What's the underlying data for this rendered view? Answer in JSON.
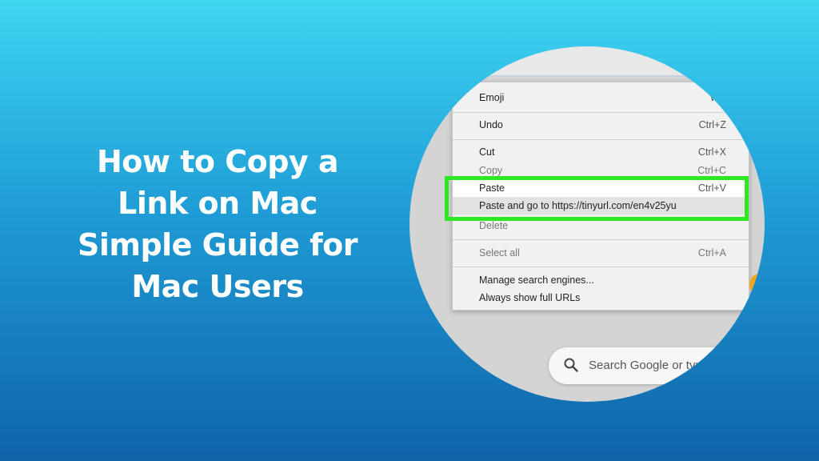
{
  "headline": {
    "lines": [
      "How to Copy a",
      "Link on Mac",
      "Simple Guide for",
      "Mac Users"
    ]
  },
  "context_menu": {
    "items": [
      {
        "label": "Emoji",
        "shortcut": "Win+Per"
      },
      {
        "label": "Undo",
        "shortcut": "Ctrl+Z"
      },
      {
        "label": "Cut",
        "shortcut": "Ctrl+X"
      },
      {
        "label": "Copy",
        "shortcut": "Ctrl+C"
      },
      {
        "label": "Paste",
        "shortcut": "Ctrl+V"
      },
      {
        "label": "Paste and go to https://tinyurl.com/en4v25yu",
        "shortcut": ""
      },
      {
        "label": "Delete",
        "shortcut": ""
      },
      {
        "label": "Select all",
        "shortcut": "Ctrl+A"
      },
      {
        "label": "Manage search engines...",
        "shortcut": ""
      },
      {
        "label": "Always show full URLs",
        "shortcut": ""
      }
    ]
  },
  "search": {
    "placeholder": "Search Google or type"
  },
  "colors": {
    "highlight": "#2de820",
    "background_top": "#3fd6f2",
    "background_bottom": "#0f63a8"
  }
}
